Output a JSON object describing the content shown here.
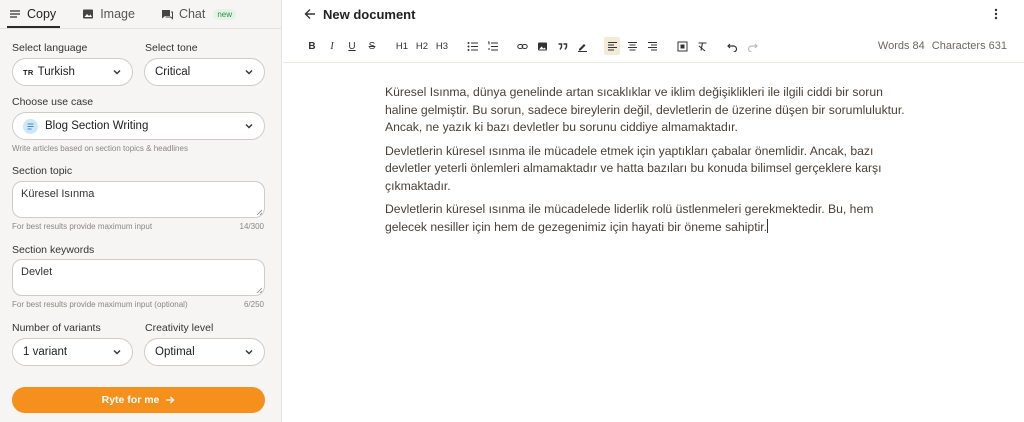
{
  "tabs": [
    {
      "label": "Copy"
    },
    {
      "label": "Image"
    },
    {
      "label": "Chat",
      "badge": "new"
    }
  ],
  "form": {
    "language": {
      "label": "Select language",
      "code": "TR",
      "value": "Turkish"
    },
    "tone": {
      "label": "Select tone",
      "value": "Critical"
    },
    "use_case": {
      "label": "Choose use case",
      "value": "Blog Section Writing",
      "hint": "Write articles based on section topics & headlines"
    },
    "topic": {
      "label": "Section topic",
      "value": "Küresel Isınma",
      "hint": "For best results provide maximum input",
      "counter": "14/300"
    },
    "keywords": {
      "label": "Section keywords",
      "value": "Devlet",
      "hint": "For best results provide maximum input (optional)",
      "counter": "6/250"
    },
    "variants": {
      "label": "Number of variants",
      "value": "1 variant"
    },
    "creativity": {
      "label": "Creativity level",
      "value": "Optimal"
    },
    "submit_label": "Ryte for me"
  },
  "document": {
    "title": "New document",
    "toolbar": {
      "h1": "H1",
      "h2": "H2",
      "h3": "H3"
    },
    "stats": {
      "words": "Words 84",
      "characters": "Characters 631"
    },
    "paragraphs": [
      "Küresel Isınma, dünya genelinde artan sıcaklıklar ve iklim değişiklikleri ile ilgili ciddi bir sorun haline gelmiştir. Bu sorun, sadece bireylerin değil, devletlerin de üzerine düşen bir sorumluluktur. Ancak, ne yazık ki bazı devletler bu sorunu ciddiye almamaktadır.",
      "Devletlerin küresel ısınma ile mücadele etmek için yaptıkları çabalar önemlidir. Ancak, bazı devletler yeterli önlemleri almamaktadır ve hatta bazıları bu konuda bilimsel gerçeklere karşı çıkmaktadır.",
      "Devletlerin küresel ısınma ile mücadelede liderlik rolü üstlenmeleri gerekmektedir. Bu, hem gelecek nesiller için hem de gezegenimiz için hayati bir öneme sahiptir."
    ]
  },
  "colors": {
    "accent": "#f6901d",
    "panel": "#f6f5f3"
  },
  "icons": [
    "hamburger-icon",
    "image-icon",
    "chat-icon",
    "chevron-down-icon",
    "arrow-left-icon",
    "kebab-menu-icon",
    "link-icon",
    "quote-icon",
    "undo-icon",
    "redo-icon"
  ]
}
